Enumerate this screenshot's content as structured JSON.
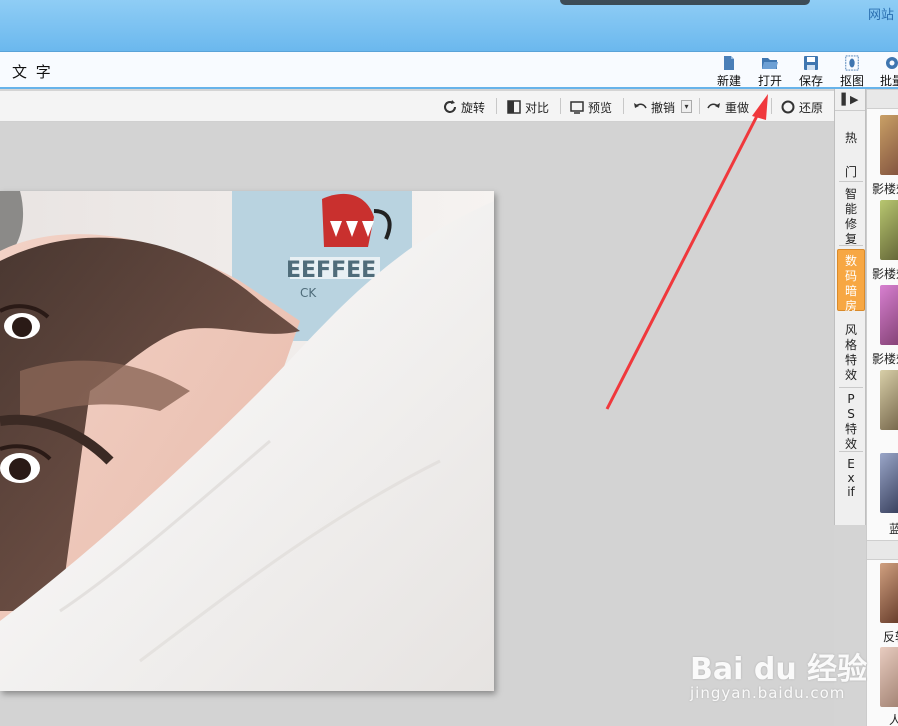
{
  "titlebar": {
    "corner_text": "网站"
  },
  "menu": {
    "text_label": "文 字"
  },
  "toolbar": {
    "new_label": "新建",
    "open_label": "打开",
    "save_label": "保存",
    "cutout_label": "抠图",
    "batch_label": "批量"
  },
  "editbar": {
    "rotate_label": "旋转",
    "compare_label": "对比",
    "preview_label": "预览",
    "undo_label": "撤销",
    "redo_label": "重做",
    "restore_label": "还原"
  },
  "side_tabs": {
    "hot_label": "热门",
    "smart_repair_label": "智能修复",
    "digital_darkroom_label": "数码暗房",
    "style_effects_label": "风格特效",
    "ps_effects_label": "PS特效",
    "exif_label": "Exif"
  },
  "thumbnails": {
    "items": [
      {
        "label": "影楼效"
      },
      {
        "label": "影楼效"
      },
      {
        "label": "影楼效"
      },
      {
        "label": ""
      },
      {
        "label": "蓝"
      }
    ],
    "section2": [
      {
        "label": "反转"
      },
      {
        "label": "人"
      }
    ]
  },
  "watermark": {
    "logo": "Bai du 经验",
    "url": "jingyan.baidu.com"
  },
  "colors": {
    "accent": "#f7a743",
    "title_blue": "#79c0f0",
    "arrow": "#f0383c"
  }
}
